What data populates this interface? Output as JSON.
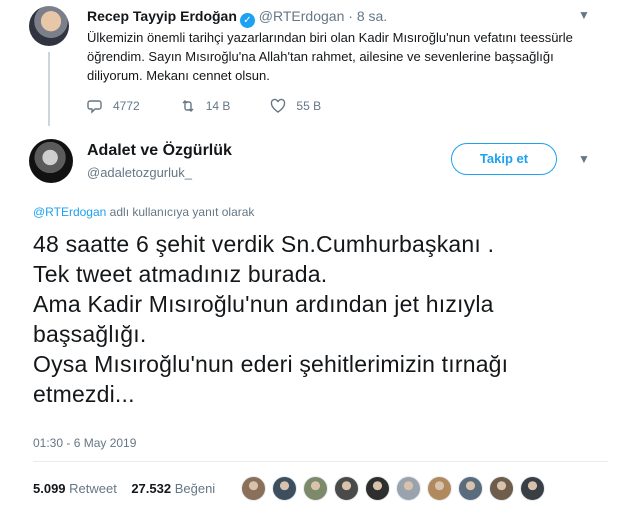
{
  "parent_tweet": {
    "name": "Recep Tayyip Erdoğan",
    "verified_glyph": "✓",
    "handle": "@RTErdogan",
    "separator": "·",
    "time": "8 sa.",
    "text": "Ülkemizin önemli tarihçi yazarlarından biri olan Kadir Mısıroğlu'nun vefatını teessürle öğrendim. Sayın Mısıroğlu'na Allah'tan rahmet, ailesine ve sevenlerine başsağlığı diliyorum. Mekanı cennet olsun.",
    "replies": "4772",
    "retweets": "14 B",
    "likes": "55 B"
  },
  "main_tweet": {
    "name": "Adalet ve Özgürlük",
    "handle": "@adaletozgurluk_",
    "follow_label": "Takip et",
    "reply_to_handle": "@RTErdogan",
    "reply_to_suffix": " adlı kullanıcıya yanıt olarak",
    "text_lines": [
      "48 saatte 6 şehit verdik Sn.Cumhurbaşkanı .",
      "Tek tweet atmadınız burada.",
      "Ama Kadir Mısıroğlu'nun ardından jet hızıyla",
      "başsağlığı.",
      "Oysa Mısıroğlu'nun ederi şehitlerimizin tırnağı",
      "etmezdi..."
    ],
    "timestamp": "01:30 - 6 May 2019",
    "retweet_count": "5.099",
    "retweet_label": "Retweet",
    "like_count": "27.532",
    "like_label": "Beğeni"
  },
  "icons": {
    "reply": "reply-icon",
    "retweet": "retweet-icon",
    "like": "heart-icon",
    "more": "chevron-down-icon"
  },
  "colors": {
    "accent": "#1da1f2",
    "secondary_text": "#657786",
    "divider": "#e6ecf0",
    "thread_line": "#ccd6dd"
  },
  "liker_avatar_colors": [
    "#8a6f5a",
    "#3d4f5f",
    "#7c8a6a",
    "#4a4a4a",
    "#2e2e2e",
    "#9aa3ad",
    "#b08a5e",
    "#5a6b7c",
    "#6e5d4a",
    "#3a3f46"
  ]
}
